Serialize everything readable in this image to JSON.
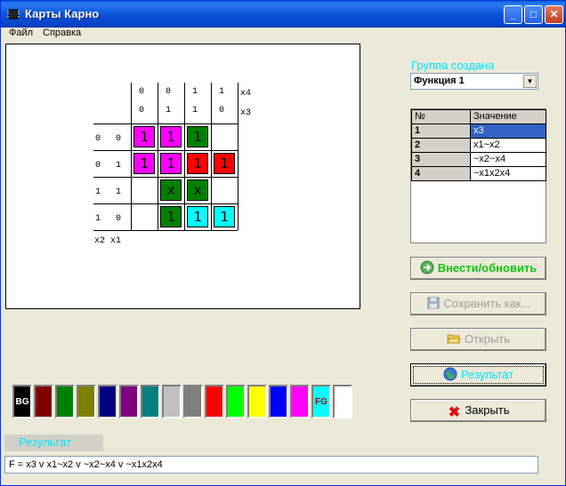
{
  "window": {
    "title": "Карты Карно"
  },
  "menu": [
    {
      "label": "Файл"
    },
    {
      "label": "Справка"
    }
  ],
  "kmap": {
    "col_x4": [
      "0",
      "0",
      "1",
      "1"
    ],
    "col_x3": [
      "0",
      "1",
      "1",
      "0"
    ],
    "label_x4": "x4",
    "label_x3": "x3",
    "row_x2": [
      "0",
      "0",
      "1",
      "1"
    ],
    "row_x1": [
      "0",
      "1",
      "1",
      "0"
    ],
    "label_rows": "x2 x1",
    "cells": [
      [
        {
          "v": "1",
          "c": "#ff00ff"
        },
        {
          "v": "1",
          "c": "#ff00ff"
        },
        {
          "v": "1",
          "c": "#008000"
        },
        {
          "v": "",
          "c": ""
        }
      ],
      [
        {
          "v": "1",
          "c": "#ff00ff"
        },
        {
          "v": "1",
          "c": "#ff00ff"
        },
        {
          "v": "1",
          "c": "#ff0000"
        },
        {
          "v": "1",
          "c": "#ff0000"
        }
      ],
      [
        {
          "v": "",
          "c": ""
        },
        {
          "v": "x",
          "c": "#008000"
        },
        {
          "v": "x",
          "c": "#008000"
        },
        {
          "v": "",
          "c": ""
        }
      ],
      [
        {
          "v": "",
          "c": ""
        },
        {
          "v": "1",
          "c": "#008000"
        },
        {
          "v": "1",
          "c": "#00ffff"
        },
        {
          "v": "1",
          "c": "#00ffff"
        }
      ]
    ]
  },
  "groups": {
    "title": "Группа создана",
    "selected": "Функция 1",
    "header_num": "№",
    "header_value": "Значение",
    "rows": [
      {
        "num": "1",
        "value": "x3"
      },
      {
        "num": "2",
        "value": "x1~x2"
      },
      {
        "num": "3",
        "value": "~x2~x4"
      },
      {
        "num": "4",
        "value": "~x1x2x4"
      }
    ]
  },
  "buttons": {
    "update": "Внести/обновить",
    "save": "Сохранить как...",
    "open": "Открыть",
    "result": "Результат",
    "close": "Закрыть"
  },
  "palette": {
    "bg_label": "BG",
    "fg_label": "FG",
    "colors": [
      "#000000",
      "#800000",
      "#008000",
      "#808000",
      "#000080",
      "#800080",
      "#008080",
      "#c0c0c0",
      "#808080",
      "#ff0000",
      "#00ff00",
      "#ffff00",
      "#0000ff",
      "#ff00ff",
      "#00ffff",
      "#ffffff"
    ]
  },
  "result": {
    "tab_label": "Результат",
    "formula": "F = x3 v x1~x2 v ~x2~x4 v ~x1x2x4"
  },
  "colors": {
    "accent": "#00e5ff",
    "titlebar": "#0a53d8",
    "selection": "#3163c5"
  }
}
